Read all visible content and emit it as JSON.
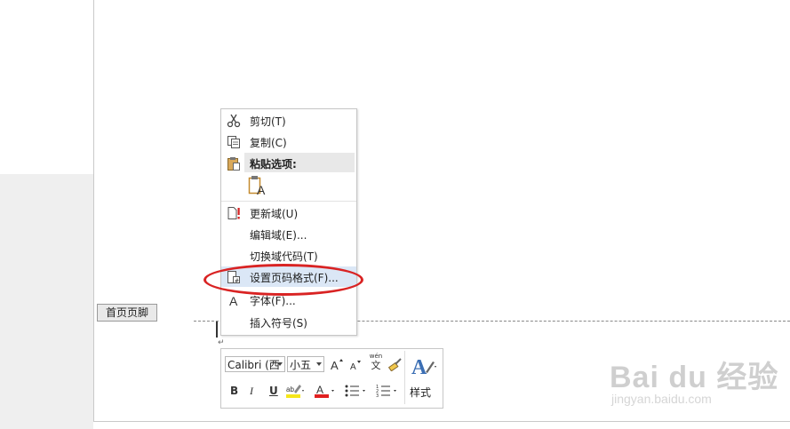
{
  "document": {
    "footer_tab_label": "首页页脚"
  },
  "context_menu": {
    "items": [
      {
        "label": "剪切(T)",
        "icon": "scissors-icon"
      },
      {
        "label": "复制(C)",
        "icon": "copy-icon"
      },
      {
        "label": "粘贴选项:",
        "icon": "paste-icon"
      },
      {
        "label": "",
        "icon": "paste-text-only-icon"
      },
      {
        "label": "更新域(U)",
        "icon": "update-field-icon"
      },
      {
        "label": "编辑域(E)...",
        "icon": ""
      },
      {
        "label": "切换域代码(T)",
        "icon": ""
      },
      {
        "label": "设置页码格式(F)...",
        "icon": "page-number-format-icon"
      },
      {
        "label": "字体(F)...",
        "icon": "font-icon"
      },
      {
        "label": "插入符号(S)",
        "icon": ""
      }
    ]
  },
  "mini_toolbar": {
    "font_name": "Calibri (西",
    "font_size": "小五",
    "phonetic_label": "wén",
    "phonetic_char": "文",
    "bold": "B",
    "italic": "I",
    "underline": "U",
    "styles_label": "样式",
    "highlight_color": "#f5e61a",
    "font_color": "#e02020"
  },
  "annotation": {
    "ellipse_color": "#d92323"
  },
  "watermark": {
    "brand": "Bai du 经验",
    "url": "jingyan.baidu.com"
  }
}
